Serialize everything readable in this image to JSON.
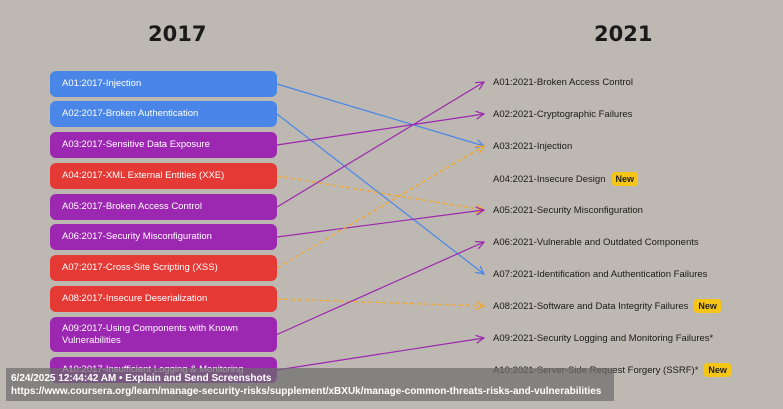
{
  "headers": {
    "left": "2017",
    "right": "2021"
  },
  "left_items": [
    {
      "label": "A01:2017-Injection",
      "color": "#4a86e8"
    },
    {
      "label": "A02:2017-Broken Authentication",
      "color": "#4a86e8"
    },
    {
      "label": "A03:2017-Sensitive Data Exposure",
      "color": "#9c27b0"
    },
    {
      "label": "A04:2017-XML External Entities (XXE)",
      "color": "#e53935"
    },
    {
      "label": "A05:2017-Broken Access Control",
      "color": "#9c27b0"
    },
    {
      "label": "A06:2017-Security Misconfiguration",
      "color": "#9c27b0"
    },
    {
      "label": "A07:2017-Cross-Site Scripting (XSS)",
      "color": "#e53935"
    },
    {
      "label": "A08:2017-Insecure Deserialization",
      "color": "#e53935"
    },
    {
      "label": "A09:2017-Using Components with Known Vulnerabilities",
      "color": "#9c27b0"
    },
    {
      "label": "A10:2017-Insufficient Logging & Monitoring",
      "color": "#9c27b0"
    }
  ],
  "right_items": [
    {
      "label": "A01:2021-Broken Access Control",
      "badge": ""
    },
    {
      "label": "A02:2021-Cryptographic Failures",
      "badge": ""
    },
    {
      "label": "A03:2021-Injection",
      "badge": ""
    },
    {
      "label": "A04:2021-Insecure Design",
      "badge": "New"
    },
    {
      "label": "A05:2021-Security Misconfiguration",
      "badge": ""
    },
    {
      "label": "A06:2021-Vulnerable and Outdated Components",
      "badge": ""
    },
    {
      "label": "A07:2021-Identification and Authentication Failures",
      "badge": ""
    },
    {
      "label": "A08:2021-Software and Data Integrity Failures",
      "badge": "New"
    },
    {
      "label": "A09:2021-Security Logging and Monitoring Failures*",
      "badge": ""
    },
    {
      "label": "A10:2021-Server-Side Request Forgery (SSRF)*",
      "badge": "New"
    }
  ],
  "mappings": [
    {
      "from": 0,
      "to": 2,
      "color": "#4a86e8",
      "dashed": false
    },
    {
      "from": 1,
      "to": 6,
      "color": "#4a86e8",
      "dashed": false
    },
    {
      "from": 2,
      "to": 1,
      "color": "#9c27b0",
      "dashed": false
    },
    {
      "from": 3,
      "to": 4,
      "color": "#f5a623",
      "dashed": true
    },
    {
      "from": 4,
      "to": 0,
      "color": "#9c27b0",
      "dashed": false
    },
    {
      "from": 5,
      "to": 4,
      "color": "#9c27b0",
      "dashed": false
    },
    {
      "from": 6,
      "to": 2,
      "color": "#f5a623",
      "dashed": true
    },
    {
      "from": 7,
      "to": 7,
      "color": "#f5a623",
      "dashed": true
    },
    {
      "from": 8,
      "to": 5,
      "color": "#9c27b0",
      "dashed": false
    },
    {
      "from": 9,
      "to": 8,
      "color": "#9c27b0",
      "dashed": false
    }
  ],
  "overlay": {
    "line1": "6/24/2025 12:44:42 AM • Explain and Send Screenshots",
    "line2": "https://www.coursera.org/learn/manage-security-risks/supplement/xBXUk/manage-common-threats-risks-and-vulnerabilities"
  }
}
